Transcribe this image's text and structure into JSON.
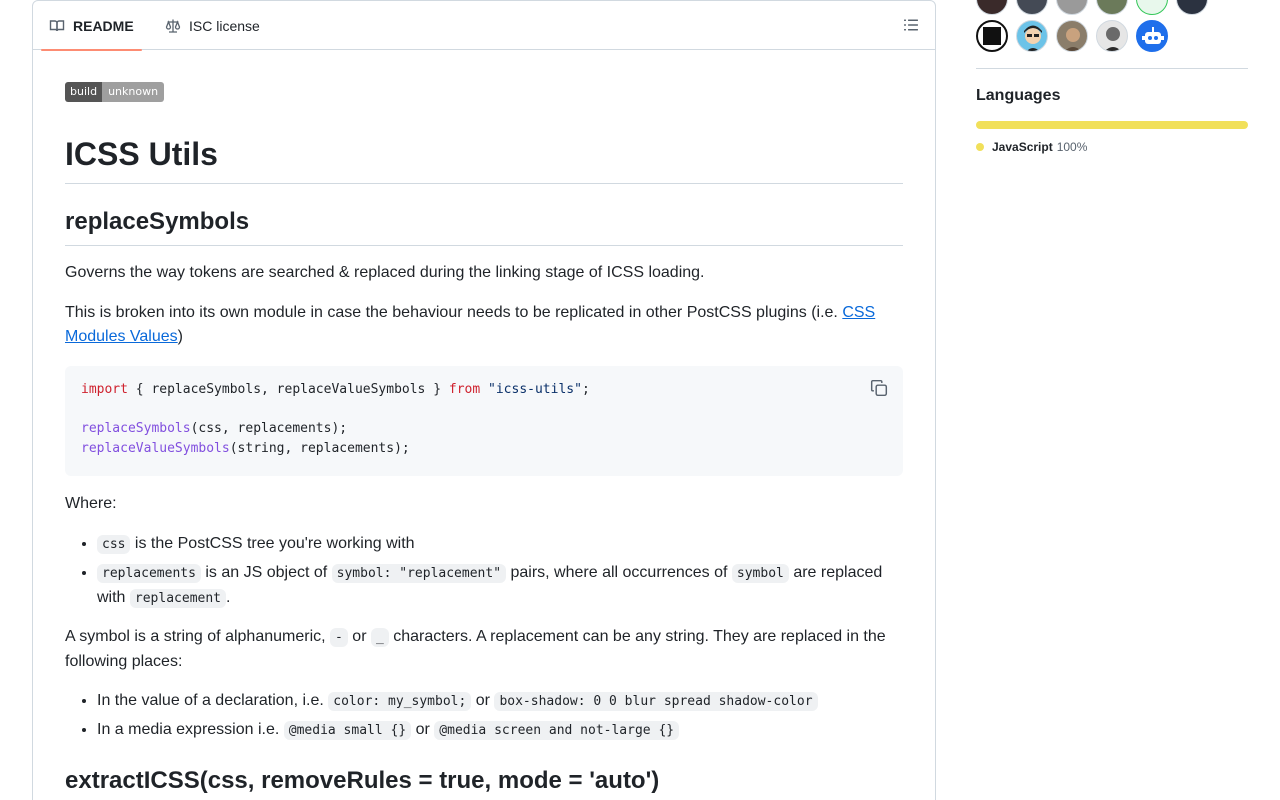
{
  "tabs": {
    "readme": "README",
    "license": "ISC license"
  },
  "badge": {
    "label": "build",
    "status": "unknown"
  },
  "readme": {
    "title": "ICSS Utils",
    "section1": "replaceSymbols",
    "p1": "Governs the way tokens are searched & replaced during the linking stage of ICSS loading.",
    "p2_before": "This is broken into its own module in case the behaviour needs to be replicated in other PostCSS plugins (i.e. ",
    "p2_link": "CSS Modules Values",
    "p2_after": ")",
    "code": {
      "l1_kw1": "import",
      "l1_mid": " { replaceSymbols, replaceValueSymbols } ",
      "l1_kw2": "from",
      "l1_str": " \"icss-utils\"",
      "l1_end": ";",
      "l2_fn": "replaceSymbols",
      "l2_rest": "(css, replacements);",
      "l3_fn": "replaceValueSymbols",
      "l3_rest": "(string, replacements);"
    },
    "where": "Where:",
    "list1": {
      "i1_code": "css",
      "i1_text": " is the PostCSS tree you're working with",
      "i2_code1": "replacements",
      "i2_text1": " is an JS object of ",
      "i2_code2": "symbol: \"replacement\"",
      "i2_text2": " pairs, where all occurrences of ",
      "i2_code3": "symbol",
      "i2_text3": " are replaced with ",
      "i2_code4": "replacement",
      "i2_text4": "."
    },
    "p4": {
      "t1": "A symbol is a string of alphanumeric, ",
      "c1": "-",
      "t2": " or ",
      "c2": "_",
      "t3": " characters. A replacement can be any string. They are replaced in the following places:"
    },
    "list2": {
      "i1_text1": "In the value of a declaration, i.e. ",
      "i1_code1": "color: my_symbol;",
      "i1_text2": " or ",
      "i1_code2": "box-shadow: 0 0 blur spread shadow-color",
      "i2_text1": "In a media expression i.e. ",
      "i2_code1": "@media small {}",
      "i2_text2": " or ",
      "i2_code2": "@media screen and not-large {}"
    },
    "section2": "extractICSS(css, removeRules = true, mode = 'auto')"
  },
  "sidebar": {
    "languages_title": "Languages",
    "language": {
      "name": "JavaScript",
      "percent": "100%",
      "fraction": 1.0,
      "color": "#f1e05a"
    }
  },
  "icons": {
    "readme": "book-icon",
    "license": "law-icon",
    "toc": "list-unordered-icon",
    "copy": "copy-icon"
  }
}
